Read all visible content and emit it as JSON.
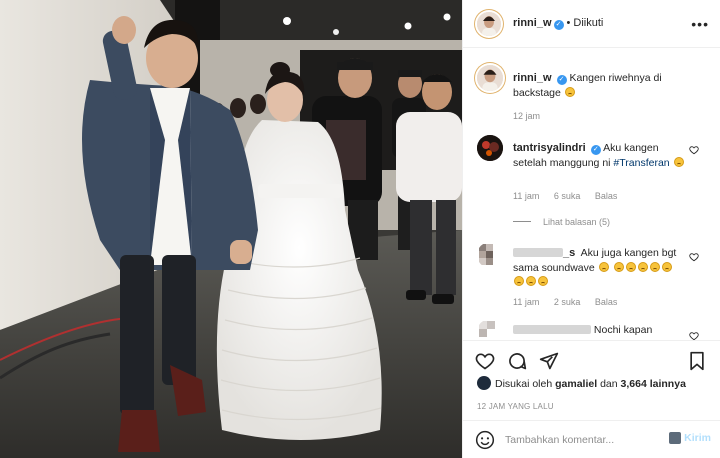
{
  "post": {
    "username": "rinni_w",
    "follow_state": "Diikuti",
    "dot": "•"
  },
  "caption": {
    "username": "rinni_w",
    "text": "Kangen riwehnya di backstage",
    "time": "12 jam"
  },
  "comments": [
    {
      "username": "tantrisyalindri",
      "text": "Aku kangen setelah manggung ni",
      "hashtag": "#Transferan",
      "time": "11 jam",
      "likes": "6 suka",
      "reply": "Balas",
      "view_replies": "Lihat balasan (5)"
    },
    {
      "username_suffix": "_s",
      "text": "Aku juga kangen bgt sama soundwave",
      "time": "11 jam",
      "likes": "2 suka",
      "reply": "Balas"
    },
    {
      "text": "Nochi kapan"
    }
  ],
  "likes": {
    "prefix": "Disukai oleh",
    "user": "gamaliel",
    "joiner": "dan",
    "count": "3,664 lainnya"
  },
  "timestamp": "12 JAM YANG LALU",
  "composer": {
    "placeholder": "Tambahkan komentar...",
    "post_label": "Kirim"
  },
  "icons": {
    "more": "more-horizontal-icon",
    "heart": "heart-icon",
    "comment": "comment-icon",
    "share": "share-icon",
    "save": "bookmark-icon",
    "emoji": "emoji-icon"
  },
  "colors": {
    "link": "#00376b",
    "verified": "#3897f0",
    "muted": "#8e8e8e",
    "post_button": "#b2dffc"
  }
}
